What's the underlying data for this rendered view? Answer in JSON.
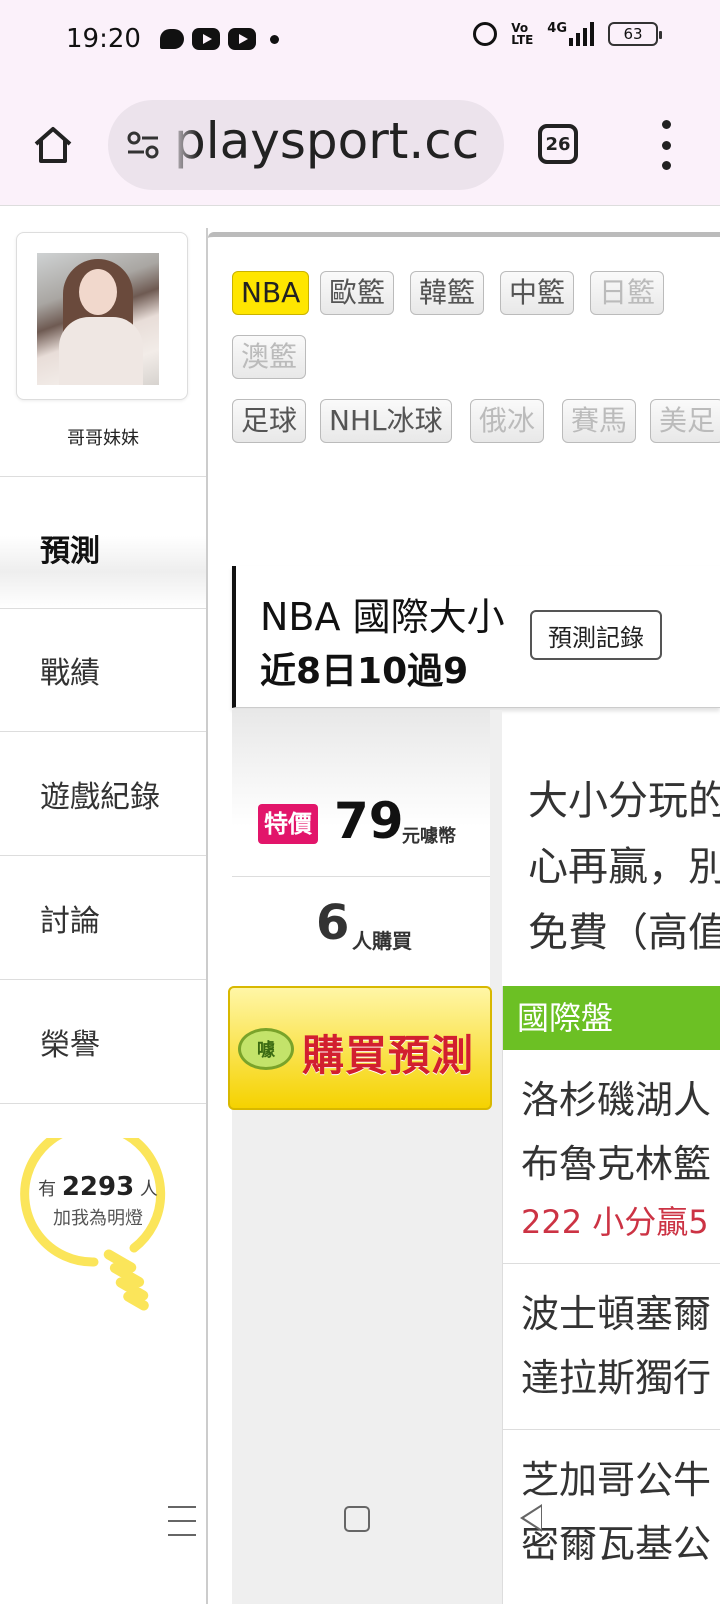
{
  "status_bar": {
    "time": "19:20",
    "network": "4G",
    "volte": "Vo LTE",
    "battery": "63"
  },
  "browser": {
    "url": "playsport.cc",
    "tab_count": "26"
  },
  "profile": {
    "name": "哥哥妹妹"
  },
  "side_menu": {
    "items": [
      {
        "label": "預測"
      },
      {
        "label": "戰績"
      },
      {
        "label": "遊戲紀錄"
      },
      {
        "label": "討論"
      },
      {
        "label": "榮譽"
      }
    ]
  },
  "lightbulb": {
    "prefix": "有",
    "count": "2293",
    "suffix": "人",
    "sub": "加我為明燈"
  },
  "categories": {
    "row1": [
      "NBA",
      "歐籃",
      "韓籃",
      "中籃",
      "日籃"
    ],
    "row2": [
      "澳籃"
    ],
    "row3": [
      "足球",
      "NHL冰球",
      "俄冰",
      "賽馬",
      "美足"
    ]
  },
  "prediction": {
    "title": "NBA 國際大小",
    "record": "近8日10過9",
    "record_button": "預測記錄"
  },
  "pricing": {
    "special_label": "特價",
    "price": "79",
    "unit": "元噱幣",
    "buyers": "6",
    "buyers_label": "人購買",
    "buy_badge": "噱",
    "buy_button": "購買預測"
  },
  "description": {
    "line1": "大小分玩的",
    "line2": "心再贏，別",
    "line3": "免費（高值"
  },
  "games": {
    "header": "國際盤",
    "list": [
      {
        "line1": "洛杉磯湖人",
        "line2": "布魯克林籃",
        "result": "222 小分贏5"
      },
      {
        "line1": "波士頓塞爾",
        "line2": "達拉斯獨行",
        "result": ""
      },
      {
        "line1": "芝加哥公牛",
        "line2": "密爾瓦基公",
        "result": ""
      }
    ]
  },
  "colors": {
    "active_tag": "#ffe600",
    "special_badge": "#e2156a",
    "games_header": "#6cc024",
    "result_text": "#cc3344",
    "buy_text": "#d21f2f"
  }
}
